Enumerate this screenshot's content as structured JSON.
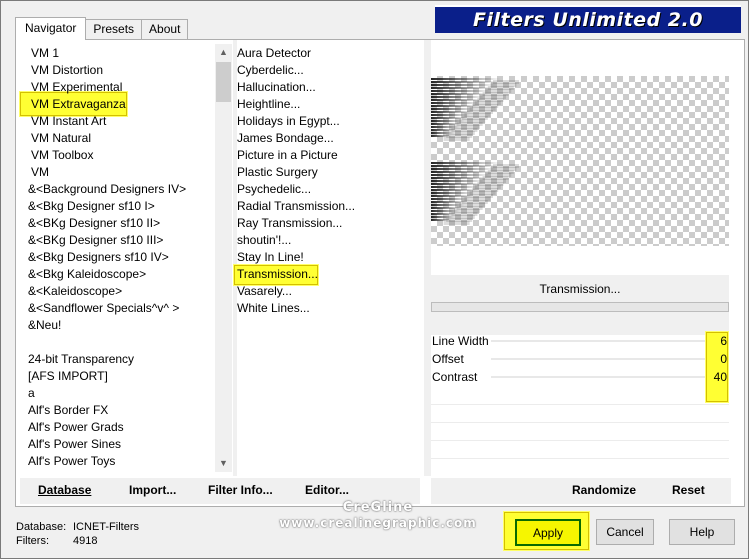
{
  "window": {
    "banner_title": "Filters Unlimited 2.0"
  },
  "tabs": [
    {
      "label": "Navigator",
      "active": true
    },
    {
      "label": "Presets",
      "active": false
    },
    {
      "label": "About",
      "active": false
    }
  ],
  "categories": [
    "VM 1",
    "VM Distortion",
    "VM Experimental",
    "VM Extravaganza",
    "VM Instant Art",
    "VM Natural",
    "VM Toolbox",
    "VM",
    "&<Background Designers IV>",
    "&<Bkg Designer sf10 I>",
    "&<BKg Designer sf10 II>",
    "&<BKg Designer sf10 III>",
    "&<Bkg Designers sf10 IV>",
    "&<Bkg Kaleidoscope>",
    "&<Kaleidoscope>",
    "&<Sandflower Specials^v^ >",
    "&Neu!",
    "",
    "24-bit Transparency",
    "[AFS IMPORT]",
    "a",
    "Alf's Border FX",
    "Alf's Power Grads",
    "Alf's Power Sines",
    "Alf's Power Toys"
  ],
  "selected_category": "VM Extravaganza",
  "filters": [
    "Aura Detector",
    "Cyberdelic...",
    "Hallucination...",
    "Heightline...",
    "Holidays in Egypt...",
    "James Bondage...",
    "Picture in a Picture",
    "Plastic Surgery",
    "Psychedelic...",
    "Radial Transmission...",
    "Ray Transmission...",
    "shoutin'!...",
    "Stay In Line!",
    "Transmission...",
    "Vasarely...",
    "White Lines..."
  ],
  "selected_filter": "Transmission...",
  "preview": {
    "filter_name": "Transmission..."
  },
  "params": [
    {
      "label": "Line Width",
      "value": "6"
    },
    {
      "label": "Offset",
      "value": "0"
    },
    {
      "label": "Contrast",
      "value": "40"
    }
  ],
  "left_buttons": {
    "database": "Database",
    "import": "Import...",
    "filter_info": "Filter Info...",
    "editor": "Editor..."
  },
  "right_buttons": {
    "randomize": "Randomize",
    "reset": "Reset"
  },
  "footer": {
    "database_label": "Database:",
    "database_value": "ICNET-Filters",
    "filters_label": "Filters:",
    "filters_value": "4918"
  },
  "watermark": {
    "line1": "CreGline",
    "line2": "www.crealinegraphic.com"
  },
  "dialog_buttons": {
    "apply": "Apply",
    "cancel": "Cancel",
    "help": "Help"
  },
  "colors": {
    "banner": "#0a1f8a",
    "highlight": "#ffff33"
  }
}
